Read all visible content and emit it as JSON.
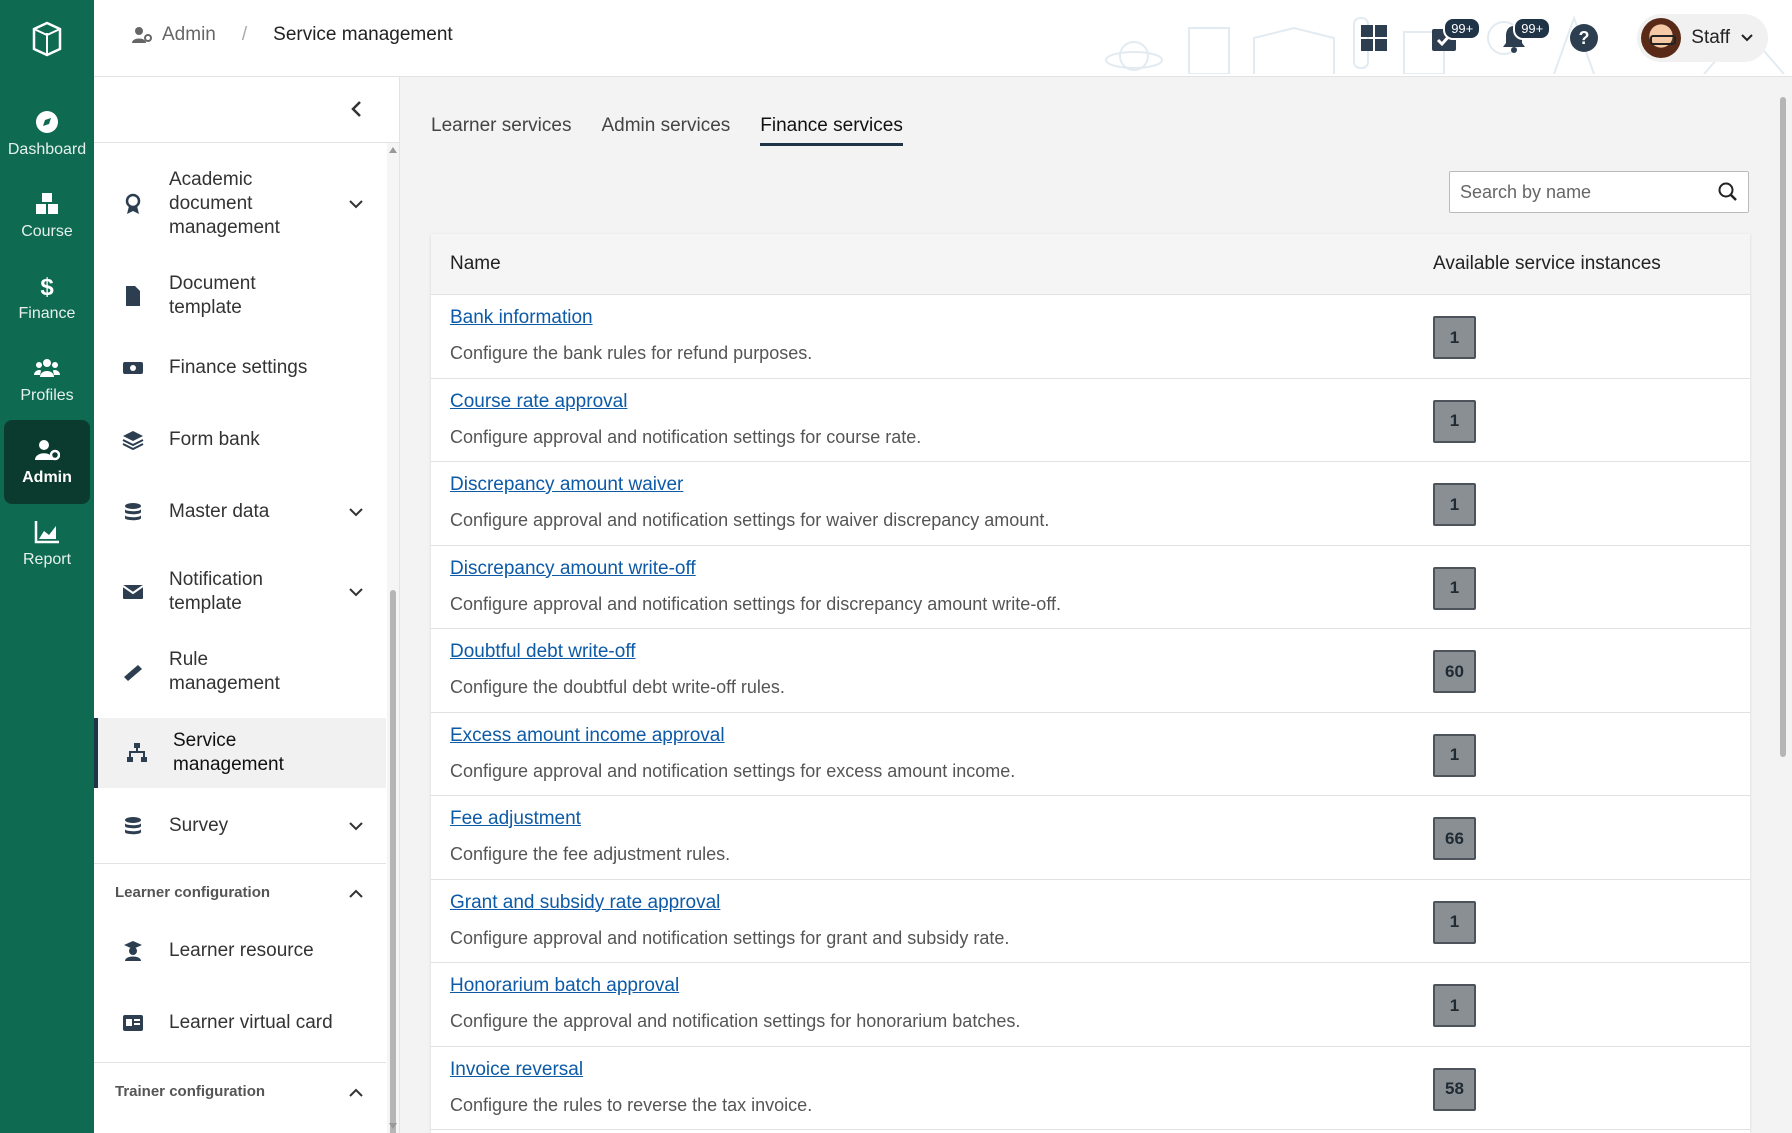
{
  "rail": {
    "items": [
      {
        "label": "Dashboard",
        "icon": "compass-icon"
      },
      {
        "label": "Course",
        "icon": "cubes-icon"
      },
      {
        "label": "Finance",
        "icon": "dollar-icon"
      },
      {
        "label": "Profiles",
        "icon": "users-icon"
      },
      {
        "label": "Admin",
        "icon": "user-gear-icon"
      },
      {
        "label": "Report",
        "icon": "chart-icon"
      }
    ],
    "active": "Admin"
  },
  "header": {
    "breadcrumb_root": "Admin",
    "breadcrumb_current": "Service management",
    "task_badge": "99+",
    "notif_badge": "99+",
    "user_name": "Staff"
  },
  "sidebar": {
    "items": [
      {
        "label": "Academic document management",
        "icon": "award-icon",
        "expandable": true
      },
      {
        "label": "Document template",
        "icon": "file-icon",
        "expandable": false
      },
      {
        "label": "Finance settings",
        "icon": "money-icon",
        "expandable": false
      },
      {
        "label": "Form bank",
        "icon": "layers-icon",
        "expandable": false
      },
      {
        "label": "Master data",
        "icon": "database-icon",
        "expandable": true
      },
      {
        "label": "Notification template",
        "icon": "envelope-icon",
        "expandable": true
      },
      {
        "label": "Rule management",
        "icon": "ruler-icon",
        "expandable": false
      },
      {
        "label": "Service management",
        "icon": "sitemap-icon",
        "expandable": false
      },
      {
        "label": "Survey",
        "icon": "database-icon",
        "expandable": true
      }
    ],
    "section_learner": "Learner configuration",
    "learner_items": [
      {
        "label": "Learner resource",
        "icon": "graduate-icon"
      },
      {
        "label": "Learner virtual card",
        "icon": "id-card-icon"
      }
    ],
    "section_trainer": "Trainer configuration"
  },
  "tabs": [
    {
      "label": "Learner services"
    },
    {
      "label": "Admin services"
    },
    {
      "label": "Finance services"
    }
  ],
  "active_tab": "Finance services",
  "search": {
    "placeholder": "Search by name"
  },
  "table": {
    "col_name": "Name",
    "col_instances": "Available service instances",
    "rows": [
      {
        "name": "Bank information",
        "description": "Configure the bank rules for refund purposes.",
        "count": "1"
      },
      {
        "name": "Course rate approval",
        "description": "Configure approval and notification settings for course rate.",
        "count": "1"
      },
      {
        "name": "Discrepancy amount waiver",
        "description": "Configure approval and notification settings for waiver discrepancy amount.",
        "count": "1"
      },
      {
        "name": "Discrepancy amount write-off",
        "description": "Configure approval and notification settings for discrepancy amount write-off.",
        "count": "1"
      },
      {
        "name": "Doubtful debt write-off",
        "description": "Configure the doubtful debt write-off rules.",
        "count": "60"
      },
      {
        "name": "Excess amount income approval",
        "description": "Configure approval and notification settings for excess amount income.",
        "count": "1"
      },
      {
        "name": "Fee adjustment",
        "description": "Configure the fee adjustment rules.",
        "count": "66"
      },
      {
        "name": "Grant and subsidy rate approval",
        "description": "Configure approval and notification settings for grant and subsidy rate.",
        "count": "1"
      },
      {
        "name": "Honorarium batch approval",
        "description": "Configure the approval and notification settings for honorarium batches.",
        "count": "1"
      },
      {
        "name": "Invoice reversal",
        "description": "Configure the rules to reverse the tax invoice.",
        "count": "58"
      }
    ]
  },
  "colors": {
    "rail": "#0f6a52",
    "rail_active": "#0b3b2e",
    "link": "#0d5aa7",
    "badge": "#1f3447"
  }
}
